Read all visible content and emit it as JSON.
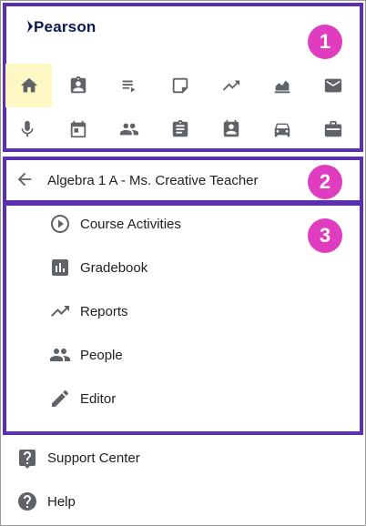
{
  "header": {
    "logo_text": "Pearson",
    "badge": "1"
  },
  "app_bar": {
    "row1": [
      {
        "icon": "home-icon",
        "active": true
      },
      {
        "icon": "assignment-ind-icon"
      },
      {
        "icon": "playlist-play-icon"
      },
      {
        "icon": "sticky-note-icon"
      },
      {
        "icon": "trending-icon"
      },
      {
        "icon": "area-chart-icon"
      },
      {
        "icon": "mail-icon"
      }
    ],
    "row2": [
      {
        "icon": "mic-icon"
      },
      {
        "icon": "calendar-icon"
      },
      {
        "icon": "people-icon"
      },
      {
        "icon": "assignment-icon"
      },
      {
        "icon": "contact-badge-icon"
      },
      {
        "icon": "car-icon"
      },
      {
        "icon": "briefcase-icon"
      }
    ]
  },
  "context": {
    "title": "Algebra 1 A - Ms. Creative Teacher",
    "badge": "2"
  },
  "course_menu": {
    "badge": "3",
    "items": [
      {
        "label": "Course Activities",
        "icon": "play-circle-icon"
      },
      {
        "label": "Gradebook",
        "icon": "bar-chart-icon"
      },
      {
        "label": "Reports",
        "icon": "trending-icon"
      },
      {
        "label": "People",
        "icon": "people-icon"
      },
      {
        "label": "Editor",
        "icon": "pencil-icon"
      }
    ]
  },
  "footer": {
    "items": [
      {
        "label": "Support Center",
        "icon": "help-box-icon"
      },
      {
        "label": "Help",
        "icon": "help-circle-icon"
      }
    ]
  },
  "colors": {
    "frame_border": "#5b2fb0",
    "badge": "#e03cc0",
    "active_bg": "#fdf7c3",
    "icon": "#5f6368"
  }
}
